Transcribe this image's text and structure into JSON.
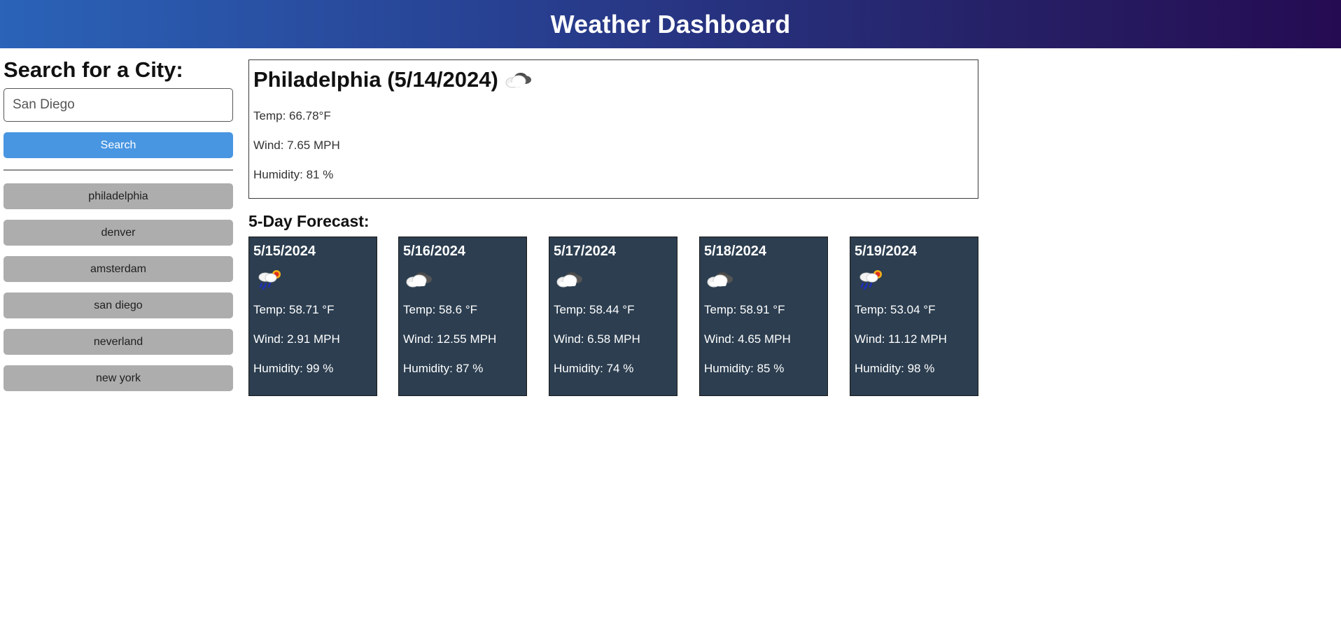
{
  "header": {
    "title": "Weather Dashboard"
  },
  "search": {
    "heading": "Search for a City:",
    "input_value": "San Diego",
    "button_label": "Search"
  },
  "history": [
    {
      "label": "philadelphia"
    },
    {
      "label": "denver"
    },
    {
      "label": "amsterdam"
    },
    {
      "label": "san diego"
    },
    {
      "label": "neverland"
    },
    {
      "label": "new york"
    }
  ],
  "current": {
    "title": "Philadelphia (5/14/2024)",
    "icon": "cloud-icon",
    "temp": "Temp: 66.78°F",
    "wind": "Wind: 7.65 MPH",
    "humidity": "Humidity: 81 %"
  },
  "forecast": {
    "heading": "5-Day Forecast:",
    "days": [
      {
        "date": "5/15/2024",
        "icon": "rain-sun-icon",
        "temp": "Temp: 58.71 °F",
        "wind": "Wind: 2.91 MPH",
        "humidity": "Humidity: 99 %"
      },
      {
        "date": "5/16/2024",
        "icon": "cloud-icon",
        "temp": "Temp: 58.6 °F",
        "wind": "Wind: 12.55 MPH",
        "humidity": "Humidity: 87 %"
      },
      {
        "date": "5/17/2024",
        "icon": "cloud-icon",
        "temp": "Temp: 58.44 °F",
        "wind": "Wind: 6.58 MPH",
        "humidity": "Humidity: 74 %"
      },
      {
        "date": "5/18/2024",
        "icon": "cloud-icon",
        "temp": "Temp: 58.91 °F",
        "wind": "Wind: 4.65 MPH",
        "humidity": "Humidity: 85 %"
      },
      {
        "date": "5/19/2024",
        "icon": "rain-sun-icon",
        "temp": "Temp: 53.04 °F",
        "wind": "Wind: 11.12 MPH",
        "humidity": "Humidity: 98 %"
      }
    ]
  },
  "colors": {
    "header_gradient_start": "#2a63b8",
    "header_gradient_end": "#250b52",
    "search_button": "#4896e2",
    "history_button": "#adadad",
    "forecast_card": "#2c3e50"
  }
}
